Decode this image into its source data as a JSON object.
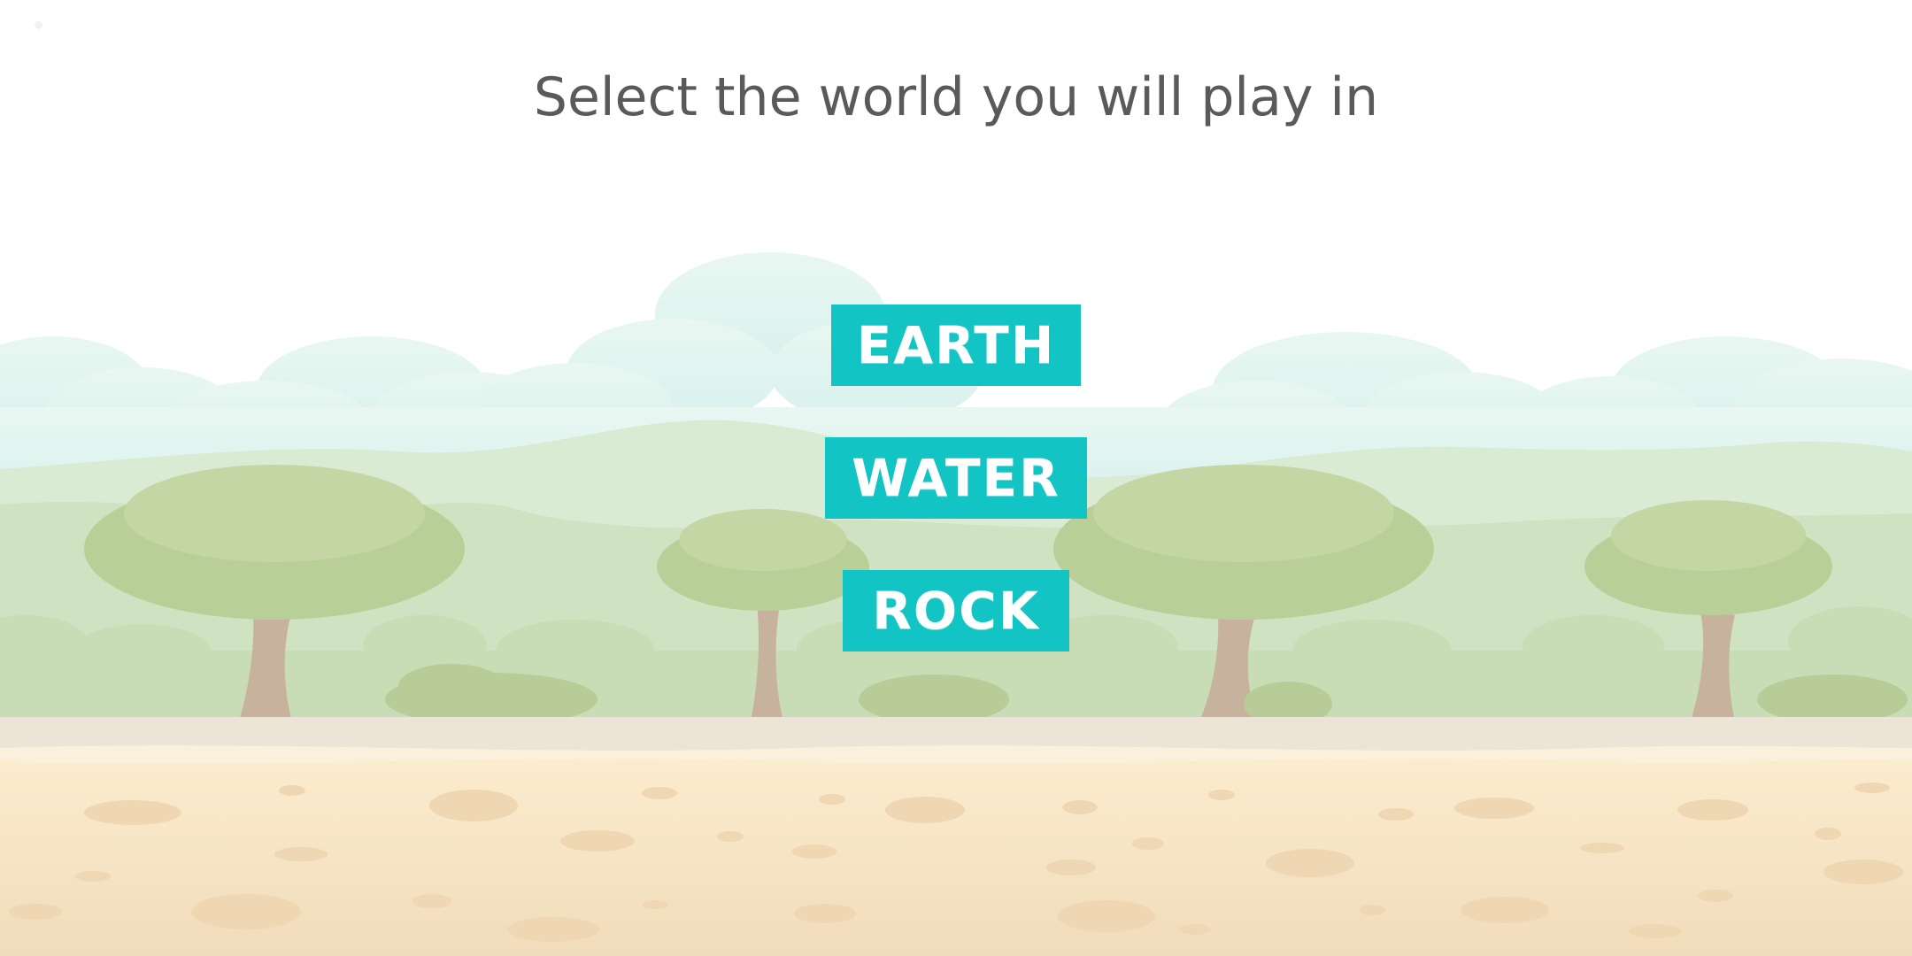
{
  "title": "Select the world you will play in",
  "worlds": [
    {
      "label": "Earth"
    },
    {
      "label": "Water"
    },
    {
      "label": "Rock"
    }
  ],
  "colors": {
    "button": "#13c4c4",
    "button_text": "#ffffff",
    "title_text": "#5a5a5a",
    "sky": "#ffffff",
    "cloud": "#dff5ef",
    "hill_far": "#d9ebd3",
    "hill_near": "#cfe2c2",
    "foliage": "#b9cf98",
    "trunk": "#c7b39d",
    "sand": "#f6e3c0"
  },
  "icons": {
    "background": "savanna-landscape",
    "tree": "tree-icon",
    "bush": "bush-icon"
  }
}
